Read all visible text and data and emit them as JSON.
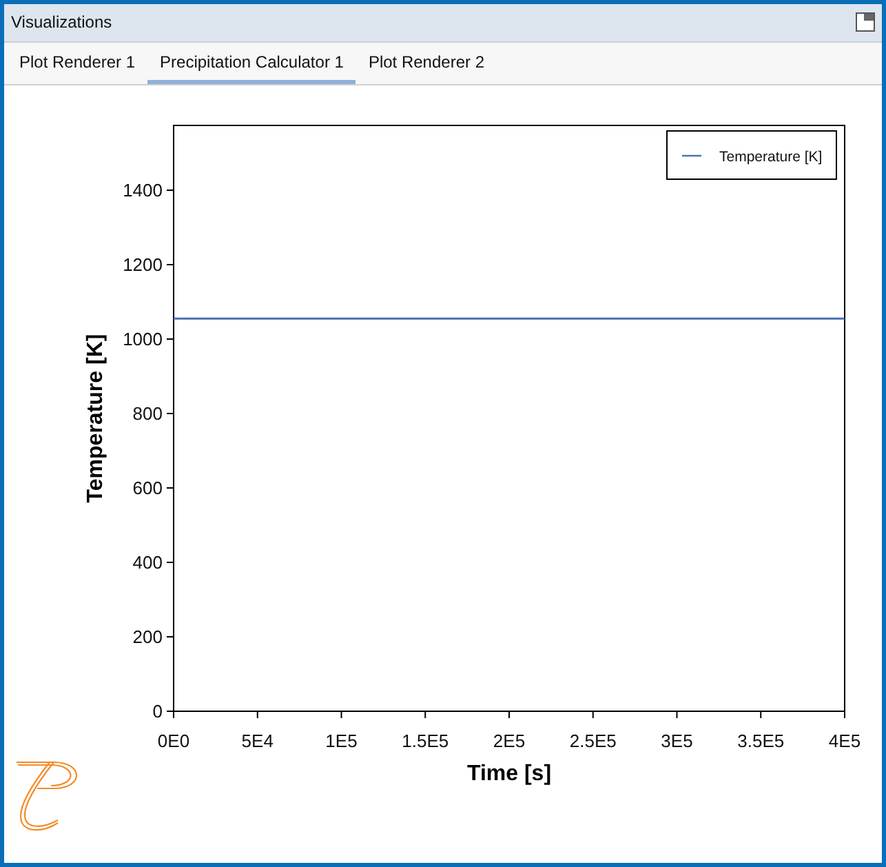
{
  "window": {
    "title": "Visualizations"
  },
  "tabs": [
    {
      "label": "Plot Renderer 1",
      "selected": false
    },
    {
      "label": "Precipitation Calculator 1",
      "selected": true
    },
    {
      "label": "Plot Renderer 2",
      "selected": false
    }
  ],
  "plot": {
    "chart_data": {
      "type": "line",
      "xlabel": "Time [s]",
      "ylabel": "Temperature [K]",
      "x": [
        0,
        400000
      ],
      "series": [
        {
          "name": "Temperature [K]",
          "color": "#4a6fb5",
          "values": [
            1055,
            1055
          ]
        }
      ],
      "xlim": [
        0,
        400000
      ],
      "ylim": [
        0,
        1574
      ],
      "xticks": [
        {
          "value": 0,
          "label": "0E0"
        },
        {
          "value": 50000,
          "label": "5E4"
        },
        {
          "value": 100000,
          "label": "1E5"
        },
        {
          "value": 150000,
          "label": "1.5E5"
        },
        {
          "value": 200000,
          "label": "2E5"
        },
        {
          "value": 250000,
          "label": "2.5E5"
        },
        {
          "value": 300000,
          "label": "3E5"
        },
        {
          "value": 350000,
          "label": "3.5E5"
        },
        {
          "value": 400000,
          "label": "4E5"
        }
      ],
      "yticks": [
        0,
        200,
        400,
        600,
        800,
        1000,
        1200,
        1400
      ]
    }
  }
}
